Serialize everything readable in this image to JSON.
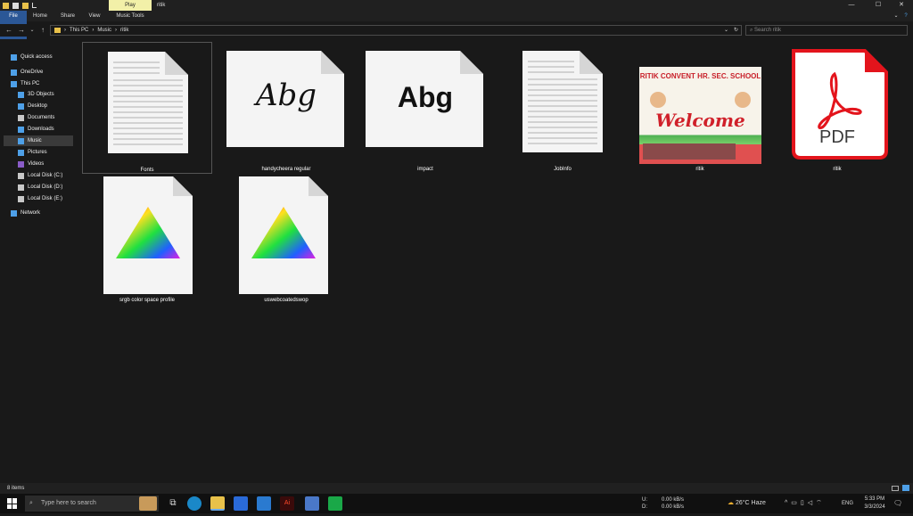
{
  "window": {
    "title": "ritik",
    "context_tab": "Play",
    "context_group": "Music Tools",
    "controls": [
      "—",
      "☐",
      "✕"
    ]
  },
  "ribbon": {
    "tabs": [
      "File",
      "Home",
      "Share",
      "View",
      "Music Tools"
    ]
  },
  "address": {
    "path": [
      "This PC",
      "Music",
      "ritik"
    ],
    "search_placeholder": "Search ritik"
  },
  "sidebar": {
    "items": [
      {
        "label": "Quick access",
        "icon": "star-icon",
        "color": "#4ea0e8"
      },
      {
        "label": "OneDrive",
        "icon": "cloud-icon",
        "color": "#4ea0e8"
      },
      {
        "label": "This PC",
        "icon": "computer-icon",
        "color": "#4ea0e8"
      },
      {
        "label": "3D Objects",
        "icon": "cube-icon",
        "color": "#4ea0e8"
      },
      {
        "label": "Desktop",
        "icon": "desktop-icon",
        "color": "#4ea0e8"
      },
      {
        "label": "Documents",
        "icon": "document-icon",
        "color": "#c8c8c8"
      },
      {
        "label": "Downloads",
        "icon": "download-icon",
        "color": "#4ea0e8"
      },
      {
        "label": "Music",
        "icon": "music-icon",
        "color": "#4ea0e8"
      },
      {
        "label": "Pictures",
        "icon": "picture-icon",
        "color": "#4ea0e8"
      },
      {
        "label": "Videos",
        "icon": "video-icon",
        "color": "#8a5cc8"
      },
      {
        "label": "Local Disk (C:)",
        "icon": "drive-icon",
        "color": "#c8c8c8"
      },
      {
        "label": "Local Disk (D:)",
        "icon": "drive-icon",
        "color": "#c8c8c8"
      },
      {
        "label": "Local Disk (E:)",
        "icon": "drive-icon",
        "color": "#c8c8c8"
      },
      {
        "label": "Network",
        "icon": "network-icon",
        "color": "#4ea0e8"
      }
    ],
    "selected": "Music"
  },
  "files": [
    {
      "name": "Fonts",
      "type": "text-doc"
    },
    {
      "name": "handycheera regular",
      "type": "font-script",
      "preview": "Abg"
    },
    {
      "name": "impact",
      "type": "font-bold",
      "preview": "Abg"
    },
    {
      "name": "JobInfo",
      "type": "text-doc"
    },
    {
      "name": "ritik",
      "type": "image",
      "banner_title": "RITIK CONVENT HR. SEC. SCHOOL",
      "banner_text": "Welcome"
    },
    {
      "name": "ritik",
      "type": "pdf",
      "badge": "PDF"
    },
    {
      "name": "srgb color space profile",
      "type": "color-profile"
    },
    {
      "name": "uswebcoatedswop",
      "type": "color-profile"
    }
  ],
  "status": {
    "count": "8 items"
  },
  "taskbar": {
    "search_placeholder": "Type here to search",
    "net_upload_label": "U:",
    "net_download_label": "D:",
    "net_upload": "0.00 kB/s",
    "net_download": "0.00 kB/s",
    "weather": "26°C  Haze",
    "lang": "ENG",
    "time": "5:33 PM",
    "date": "3/3/2024"
  },
  "colors": {
    "accent": "#2b5796",
    "context_tab": "#f2f0a8",
    "pdf_red": "#e3141c"
  }
}
